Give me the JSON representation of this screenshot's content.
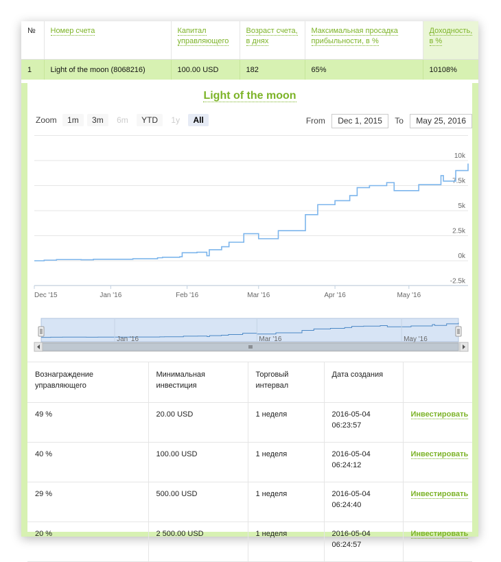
{
  "top_table": {
    "headers": {
      "num": "№",
      "account": "Номер счета",
      "capital": "Капитал управляющего",
      "age": "Возраст счета, в днях",
      "drawdown": "Максимальная просадка прибыльности, в %",
      "yield": "Доходность, в %"
    },
    "row": {
      "num": "1",
      "account": "Light of the moon (8068216)",
      "capital": "100.00 USD",
      "age": "182",
      "drawdown": "65%",
      "yield": "10108%"
    }
  },
  "chart_title": "Light of the moon",
  "zoom": {
    "label": "Zoom",
    "buttons": [
      "1m",
      "3m",
      "6m",
      "YTD",
      "1y",
      "All"
    ]
  },
  "range": {
    "from_label": "From",
    "from_value": "Dec 1, 2015",
    "to_label": "To",
    "to_value": "May 25, 2016"
  },
  "chart_data": {
    "type": "line",
    "x_start": "2015-12-01",
    "x_end": "2016-05-25",
    "x_ticks": [
      "Dec '15",
      "Jan '16",
      "Feb '16",
      "Mar '16",
      "Apr '16",
      "May '16"
    ],
    "y_ticks": [
      "10k",
      "7.5k",
      "5k",
      "2.5k",
      "0k",
      "-2.5k"
    ],
    "ylim": [
      -2500,
      12500
    ],
    "grid": true,
    "line_color": "#7cb5ec",
    "navigator_labels": [
      "Jan '16",
      "Mar '16",
      "May '16"
    ],
    "series": [
      {
        "x": [
          "2015-12-01",
          "2015-12-05",
          "2015-12-10",
          "2015-12-20",
          "2015-12-25",
          "2015-12-31",
          "2016-01-10",
          "2016-01-20",
          "2016-01-22",
          "2016-01-29",
          "2016-01-30",
          "2016-02-05",
          "2016-02-09",
          "2016-02-10",
          "2016-02-15",
          "2016-02-18",
          "2016-02-24",
          "2016-02-28",
          "2016-03-01",
          "2016-03-05",
          "2016-03-09",
          "2016-03-15",
          "2016-03-20",
          "2016-03-21",
          "2016-03-25",
          "2016-04-01",
          "2016-04-07",
          "2016-04-10",
          "2016-04-15",
          "2016-04-22",
          "2016-04-25",
          "2016-04-28",
          "2016-05-05",
          "2016-05-10",
          "2016-05-14",
          "2016-05-15",
          "2016-05-20",
          "2016-05-25"
        ],
        "y": [
          0,
          60,
          120,
          100,
          150,
          150,
          200,
          300,
          350,
          400,
          800,
          850,
          500,
          1100,
          1400,
          1850,
          2700,
          2700,
          2200,
          2200,
          3000,
          3000,
          4600,
          4600,
          5600,
          6000,
          6500,
          7300,
          7500,
          7800,
          7000,
          7000,
          7600,
          7600,
          8500,
          7950,
          9000,
          9700
        ]
      }
    ]
  },
  "bottom_table": {
    "headers": [
      "Вознаграждение управляющего",
      "Минимальная инвестиция",
      "Торговый интервал",
      "Дата создания",
      ""
    ],
    "rows": [
      {
        "fee": "49 %",
        "min": "20.00 USD",
        "interval": "1 неделя",
        "date": "2016-05-04",
        "time": "06:23:57",
        "action": "Инвестировать"
      },
      {
        "fee": "40 %",
        "min": "100.00 USD",
        "interval": "1 неделя",
        "date": "2016-05-04",
        "time": "06:24:12",
        "action": "Инвестировать"
      },
      {
        "fee": "29 %",
        "min": "500.00 USD",
        "interval": "1 неделя",
        "date": "2016-05-04",
        "time": "06:24:40",
        "action": "Инвестировать"
      },
      {
        "fee": "20 %",
        "min": "2 500.00 USD",
        "interval": "1 неделя",
        "date": "2016-05-04",
        "time": "06:24:57",
        "action": "Инвестировать"
      }
    ]
  }
}
